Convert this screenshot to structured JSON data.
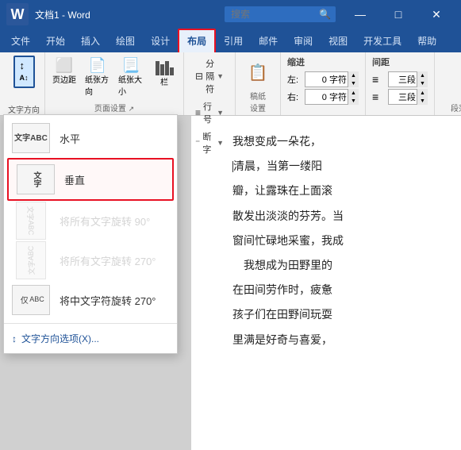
{
  "titleBar": {
    "logo": "W",
    "title": "文档1 - Word",
    "searchPlaceholder": "搜索",
    "controls": [
      "—",
      "□",
      "×"
    ]
  },
  "ribbonTabs": [
    {
      "label": "文件",
      "active": false
    },
    {
      "label": "开始",
      "active": false
    },
    {
      "label": "插入",
      "active": false
    },
    {
      "label": "绘图",
      "active": false
    },
    {
      "label": "设计",
      "active": false
    },
    {
      "label": "布局",
      "active": true,
      "highlighted": true
    },
    {
      "label": "引用",
      "active": false
    },
    {
      "label": "邮件",
      "active": false
    },
    {
      "label": "审阅",
      "active": false
    },
    {
      "label": "视图",
      "active": false
    },
    {
      "label": "开发工具",
      "active": false
    },
    {
      "label": "帮助",
      "active": false
    }
  ],
  "ribbon": {
    "textDirLabel": "文字方向",
    "marginsLabel": "页边距",
    "orientationLabel": "纸张方向",
    "sizeLabel": "纸张大小",
    "columnsLabel": "栏",
    "breakLabel": "分隔符",
    "lineNumLabel": "行号",
    "hyphenLabel": "断字",
    "pageBgLabel": "稿纸\n设置",
    "indentLeftLabel": "左:",
    "indentRightLabel": "右:",
    "indentLeftValue": "0 字符",
    "indentRightValue": "0 字符",
    "indentLabel": "缩进",
    "spacingLabel": "间距",
    "spacingBeforeLabel": "三段",
    "spacingAfterLabel": "三段",
    "arrangLabel": "段落"
  },
  "dropdown": {
    "items": [
      {
        "id": "horizontal",
        "label": "水平",
        "iconText": "文字\nABC",
        "iconStyle": "normal",
        "disabled": false
      },
      {
        "id": "vertical",
        "label": "垂直",
        "iconText": "文\n字\nA\nB\nC",
        "iconStyle": "vertical",
        "disabled": false,
        "selected": true
      },
      {
        "id": "rotate90",
        "label": "将所有文字旋转 90°",
        "iconText": "文\n字",
        "iconStyle": "rotate90",
        "disabled": true
      },
      {
        "id": "rotate270",
        "label": "将所有文字旋转 270°",
        "iconText": "文\n字",
        "iconStyle": "rotate270",
        "disabled": true
      },
      {
        "id": "rotate_cn270",
        "label": "将中文字符旋转 270°",
        "iconText": "仅\nABC",
        "iconStyle": "cn270",
        "disabled": false
      }
    ],
    "optionLink": "文字方向选项(X)..."
  },
  "document": {
    "lines": [
      "我想变成一朵花，",
      "清晨，当第一缕阳",
      "瓣，让露珠在上面滚",
      "散发出淡淡的芬芳。当",
      "窗间忙碌地采蜜，我成",
      "　我想成为田野里的",
      "在田间劳作时，疲惫",
      "孩子们在田野间玩耍",
      "里满是好奇与喜爱，"
    ]
  }
}
